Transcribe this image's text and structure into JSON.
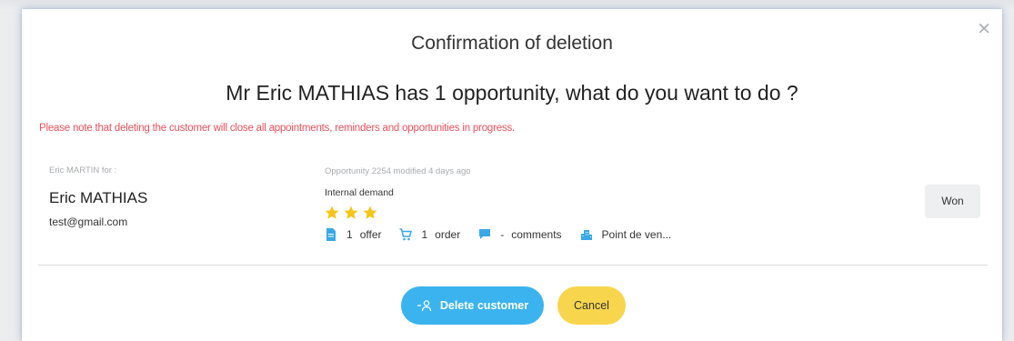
{
  "modal": {
    "title": "Confirmation of deletion",
    "close_label": "×",
    "subtitle": "Mr Eric MATHIAS has 1 opportunity, what do you want to do ?",
    "warning": "Please note that deleting the customer will close all appointments, reminders and opportunities in progress."
  },
  "customer": {
    "owner_label": "Eric MARTIN for :",
    "name": "Eric MATHIAS",
    "email": "test@gmail.com"
  },
  "opportunity": {
    "meta": "Opportunity 2254 modified 4 days ago",
    "type": "Internal demand",
    "rating": 3,
    "counts": [
      {
        "icon": "document-icon",
        "value": "1",
        "label": "offer"
      },
      {
        "icon": "cart-icon",
        "value": "1",
        "label": "order"
      },
      {
        "icon": "comment-icon",
        "value": "-",
        "label": "comments"
      },
      {
        "icon": "building-icon",
        "value": "",
        "label": "Point de ven..."
      }
    ],
    "status_button": "Won"
  },
  "actions": {
    "delete_label": "Delete customer",
    "cancel_label": "Cancel"
  },
  "colors": {
    "warning": "#e8505b",
    "primary": "#3bb3ee",
    "secondary": "#f7d54c",
    "star": "#f5c518",
    "icon": "#3aa8e8"
  }
}
